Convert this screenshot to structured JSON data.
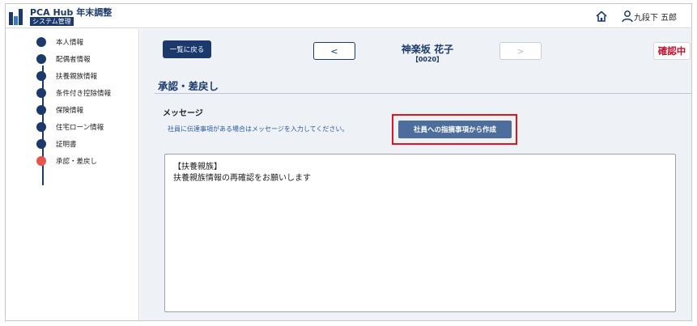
{
  "header": {
    "app_title": "PCA Hub 年末調整",
    "app_subtitle": "システム管理",
    "user_name": "九段下 五郎"
  },
  "sidebar": {
    "items": [
      {
        "label": "本人情報",
        "active": false
      },
      {
        "label": "配偶者情報",
        "active": false
      },
      {
        "label": "扶養親族情報",
        "active": false
      },
      {
        "label": "条件付き控除情報",
        "active": false
      },
      {
        "label": "保険情報",
        "active": false
      },
      {
        "label": "住宅ローン情報",
        "active": false
      },
      {
        "label": "証明書",
        "active": false
      },
      {
        "label": "承認・差戻し",
        "active": true
      }
    ]
  },
  "topbar": {
    "back_label": "一覧に戻る",
    "prev_label": "<",
    "next_label": ">",
    "employee_name": "神楽坂 花子",
    "employee_code": "【0020】",
    "status": "確認中"
  },
  "main": {
    "section_title": "承認・差戻し",
    "message_label": "メッセージ",
    "message_hint": "社員に伝達事項がある場合はメッセージを入力してください。",
    "create_button_label": "社員への指摘事項から作成",
    "message_text": "【扶養親族】\n扶養親族情報の再確認をお願いします"
  },
  "colors": {
    "brand": "#1b3a6b",
    "active_step": "#e8554e",
    "status": "#c8102e",
    "highlight": "#e0141e",
    "hint": "#2a5aa0"
  }
}
